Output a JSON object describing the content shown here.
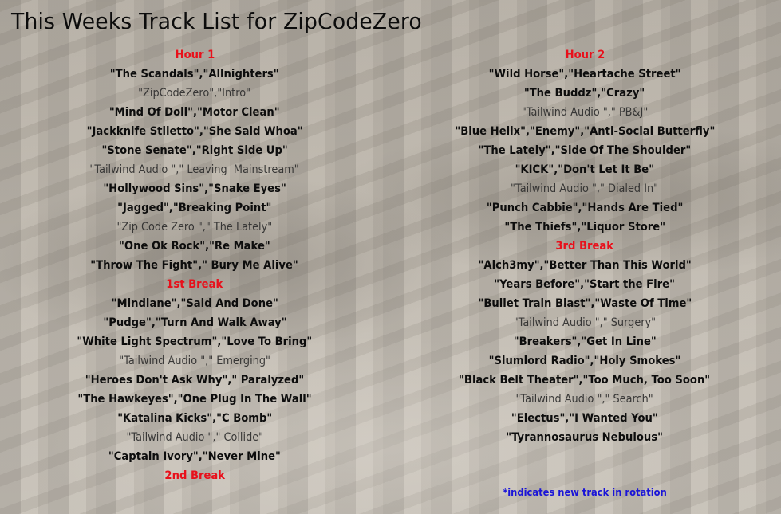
{
  "page": {
    "title": "This Weeks Track List for ZipCodeZero"
  },
  "colors": {
    "header_red": "#e8101b",
    "note_blue": "#1a14d8",
    "text_dark": "#0d0d0d"
  },
  "hour1": {
    "entries": [
      {
        "type": "header",
        "text": "Hour 1"
      },
      {
        "type": "track",
        "text": "\"The Scandals\",\"Allnighters\""
      },
      {
        "type": "station",
        "text": "\"ZipCodeZero\",\"Intro\""
      },
      {
        "type": "track",
        "text": "\"Mind Of Doll\",\"Motor Clean\""
      },
      {
        "type": "track",
        "text": "\"Jackknife Stiletto\",\"She Said Whoa\""
      },
      {
        "type": "track",
        "text": "\"Stone Senate\",\"Right Side Up\""
      },
      {
        "type": "station",
        "text": "\"Tailwind Audio \",\" Leaving  Mainstream\""
      },
      {
        "type": "track",
        "text": "\"Hollywood Sins\",\"Snake Eyes\""
      },
      {
        "type": "track",
        "text": "\"Jagged\",\"Breaking Point\""
      },
      {
        "type": "station",
        "text": "\"Zip Code Zero \",\" The Lately\""
      },
      {
        "type": "track",
        "text": "\"One Ok Rock\",\"Re Make\""
      },
      {
        "type": "track",
        "text": "\"Throw The Fight\",\" Bury Me Alive\""
      },
      {
        "type": "header",
        "text": "1st Break"
      },
      {
        "type": "track",
        "text": "\"Mindlane\",\"Said And Done\""
      },
      {
        "type": "track",
        "text": "\"Pudge\",\"Turn And Walk Away\""
      },
      {
        "type": "track",
        "text": "\"White Light Spectrum\",\"Love To Bring\""
      },
      {
        "type": "station",
        "text": "\"Tailwind Audio \",\" Emerging\""
      },
      {
        "type": "track",
        "text": "\"Heroes Don't Ask Why\",\" Paralyzed\""
      },
      {
        "type": "track",
        "text": "\"The Hawkeyes\",\"One Plug In The Wall\""
      },
      {
        "type": "track",
        "text": "\"Katalina Kicks\",\"C Bomb\""
      },
      {
        "type": "station",
        "text": "\"Tailwind Audio \",\" Collide\""
      },
      {
        "type": "track",
        "text": "\"Captain Ivory\",\"Never Mine\""
      },
      {
        "type": "header",
        "text": "2nd Break"
      }
    ]
  },
  "hour2": {
    "entries": [
      {
        "type": "header",
        "text": "Hour 2"
      },
      {
        "type": "track",
        "text": "\"Wild Horse\",\"Heartache Street\""
      },
      {
        "type": "track",
        "text": "\"The Buddz\",\"Crazy\""
      },
      {
        "type": "station",
        "text": "\"Tailwind Audio \",\" PB&J\""
      },
      {
        "type": "track",
        "text": "\"Blue Helix\",\"Enemy\",\"Anti-Social Butterfly\""
      },
      {
        "type": "track",
        "text": "\"The Lately\",\"Side Of The Shoulder\""
      },
      {
        "type": "track",
        "text": "\"KICK\",\"Don't Let It Be\""
      },
      {
        "type": "station",
        "text": "\"Tailwind Audio \",\" Dialed In\""
      },
      {
        "type": "track",
        "text": "\"Punch Cabbie\",\"Hands Are Tied\""
      },
      {
        "type": "track",
        "text": "\"The Thiefs\",\"Liquor Store\""
      },
      {
        "type": "header",
        "text": "3rd Break"
      },
      {
        "type": "track",
        "text": "\"Alch3my\",\"Better Than This World\""
      },
      {
        "type": "track",
        "text": "\"Years Before\",\"Start the Fire\""
      },
      {
        "type": "track",
        "text": "\"Bullet Train Blast\",\"Waste Of Time\""
      },
      {
        "type": "station",
        "text": "\"Tailwind Audio \",\" Surgery\""
      },
      {
        "type": "track",
        "text": "\"Breakers\",\"Get In Line\""
      },
      {
        "type": "track",
        "text": "\"Slumlord Radio\",\"Holy Smokes\""
      },
      {
        "type": "track",
        "text": "\"Black Belt Theater\",\"Too Much, Too Soon\""
      },
      {
        "type": "station",
        "text": "\"Tailwind Audio \",\" Search\""
      },
      {
        "type": "track",
        "text": "\"Electus\",\"I Wanted You\""
      },
      {
        "type": "track",
        "text": "\"Tyrannosaurus Nebulous\""
      }
    ]
  },
  "footnote": {
    "text": "*indicates new track in rotation"
  }
}
